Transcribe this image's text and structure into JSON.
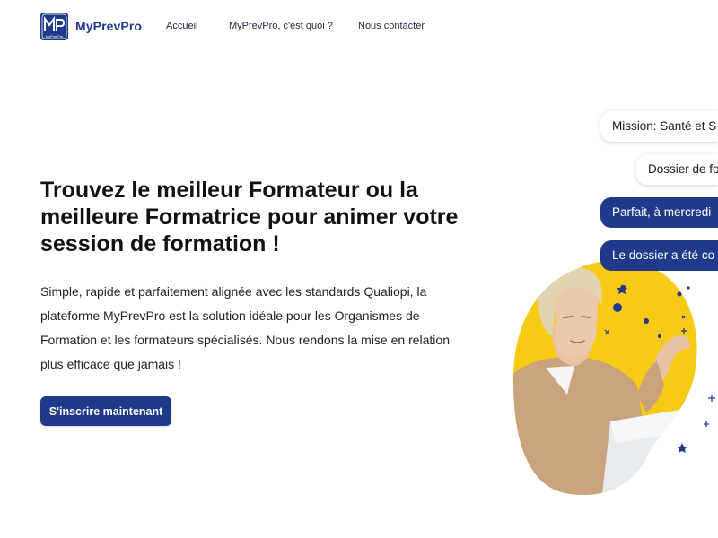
{
  "header": {
    "brand_name": "MyPrevPro",
    "logo_letters": "MP",
    "logo_subtext": "MyPrevPro",
    "nav": {
      "home": "Accueil",
      "about": "MyPrevPro, c'est quoi ?",
      "contact": "Nous contacter"
    }
  },
  "hero": {
    "title": "Trouvez le meilleur Formateur ou la meilleure Formatrice pour animer votre session de formation !",
    "description": "Simple, rapide et parfaitement alignée avec les standards Qualiopi, la plateforme MyPrevPro est la solution idéale pour les Organismes de Formation et les formateurs spécialisés. Nous rendons la mise en relation plus efficace que jamais !",
    "cta_label": "S'inscrire maintenant"
  },
  "chat": {
    "bubble_1": "Mission: Santé et S",
    "bubble_2": "Dossier de fo",
    "bubble_3": "Parfait, à mercredi",
    "bubble_4": "Le dossier a été co"
  },
  "colors": {
    "brand": "#1f3a8a",
    "accent_yellow": "#f7cb15",
    "text": "#111111"
  },
  "icons": {
    "logo": "myprevpro-logo-icon"
  }
}
